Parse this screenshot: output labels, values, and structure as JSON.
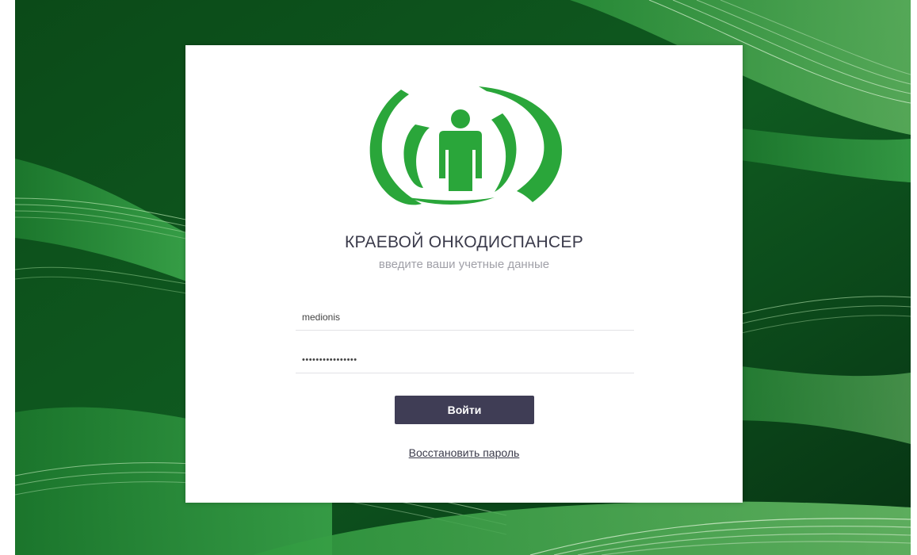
{
  "colors": {
    "background_dark": "#0a3d14",
    "background_green": "#2e8b3a",
    "logo_green": "#2aa63a",
    "button": "#3f3d55",
    "title_text": "#3a3a4a",
    "subtitle_text": "#a0a0a8"
  },
  "logo": {
    "icon": "person-signal-waves-logo"
  },
  "card": {
    "title": "КРАЕВОЙ ОНКОДИСПАНСЕР",
    "subtitle": "введите ваши учетные данные"
  },
  "form": {
    "login_value": "medionis",
    "password_value": "••••••••••••••••",
    "submit_label": "Войти",
    "restore_link": "Восстановить пароль"
  }
}
